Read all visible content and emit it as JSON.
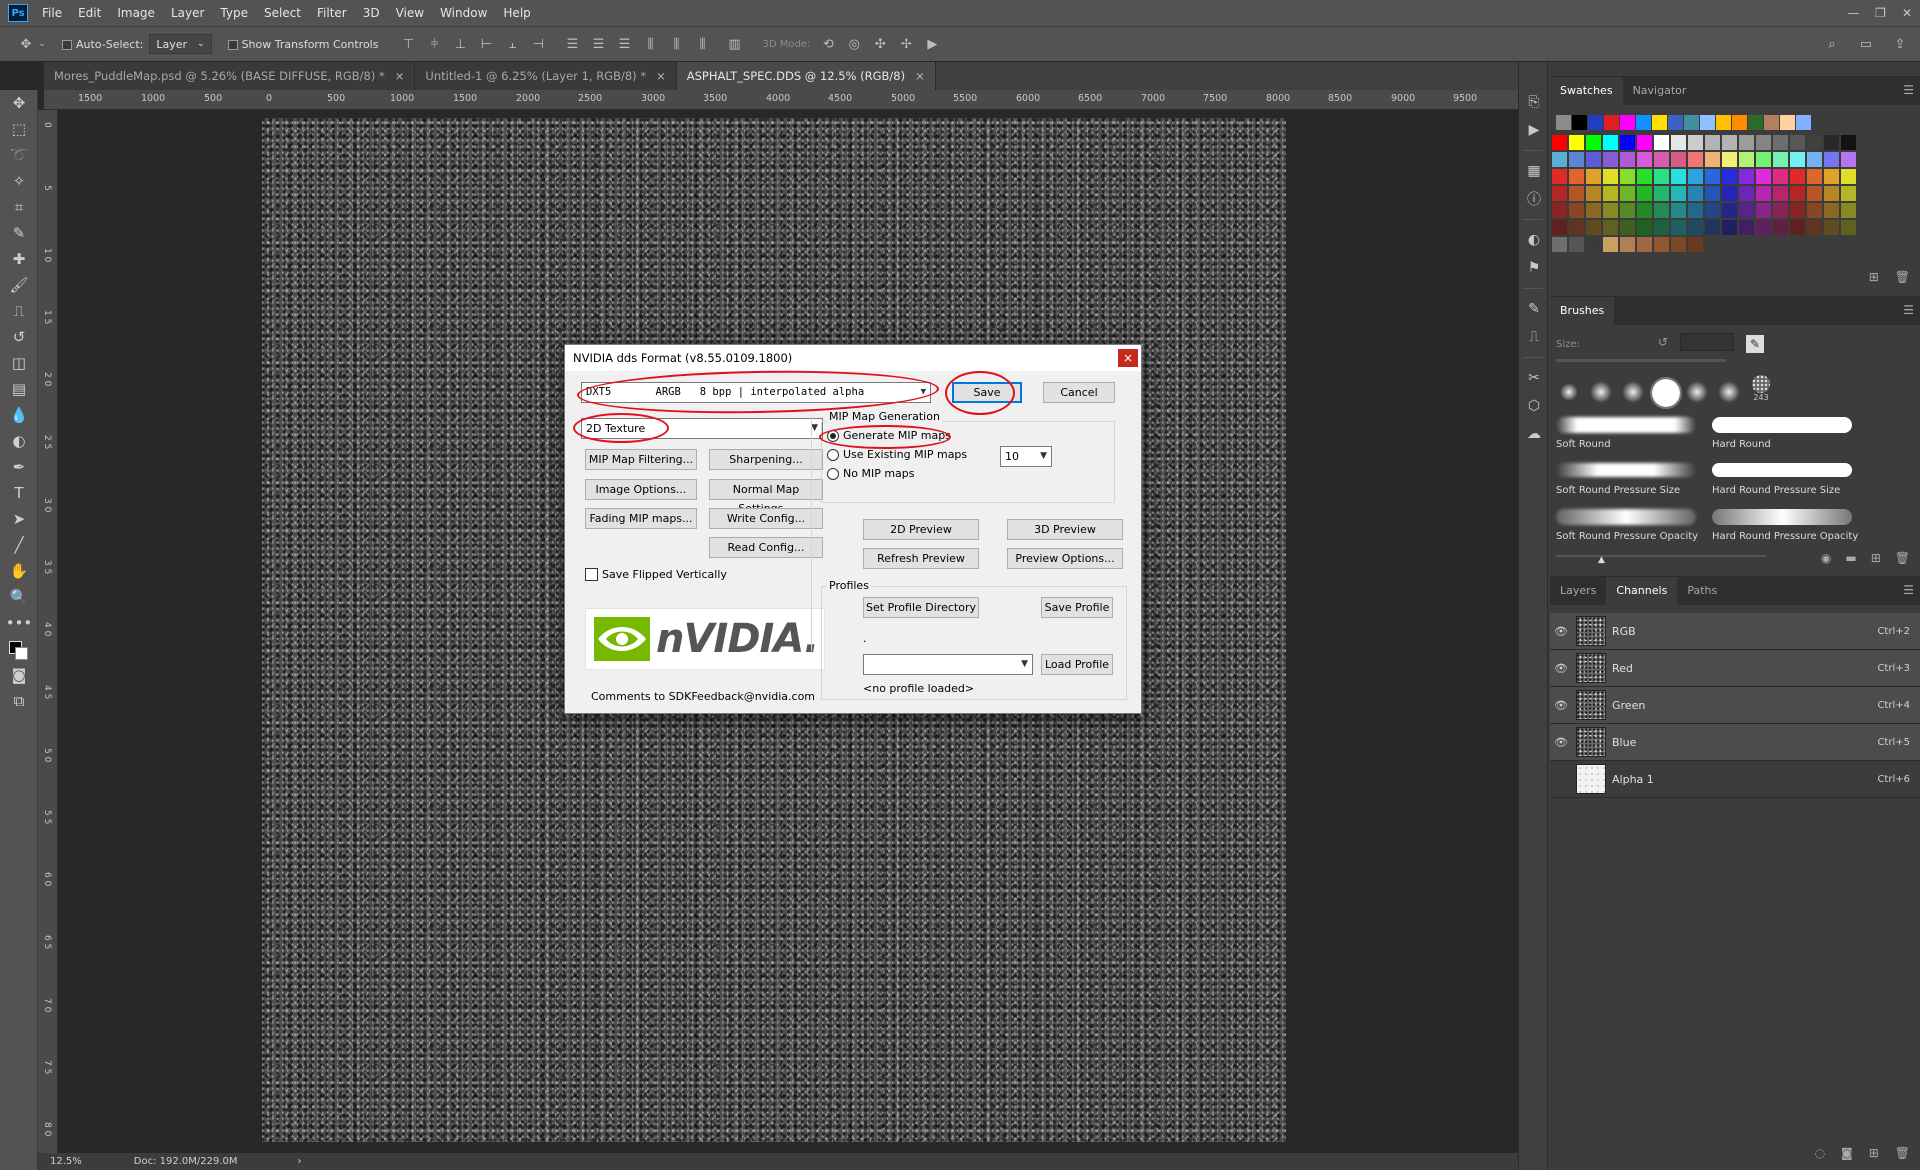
{
  "app": {
    "logo": "Ps"
  },
  "menu": [
    "File",
    "Edit",
    "Image",
    "Layer",
    "Type",
    "Select",
    "Filter",
    "3D",
    "View",
    "Window",
    "Help"
  ],
  "options": {
    "auto_select_label": "Auto-Select:",
    "auto_select_target": "Layer",
    "show_transform_label": "Show Transform Controls",
    "mode_3d_label": "3D Mode:"
  },
  "tabs": [
    {
      "label": "Mores_PuddleMap.psd @ 5.26% (BASE DIFFUSE, RGB/8) *",
      "close": "×"
    },
    {
      "label": "Untitled-1 @ 6.25% (Layer 1, RGB/8) *",
      "close": "×"
    },
    {
      "label": "ASPHALT_SPEC.DDS @ 12.5% (RGB/8)",
      "close": "×"
    }
  ],
  "ruler_top": [
    "1500",
    "1000",
    "500",
    "0",
    "500",
    "1000",
    "1500",
    "2000",
    "2500",
    "3000",
    "3500",
    "4000",
    "4500",
    "5000",
    "5500",
    "6000",
    "6500",
    "7000",
    "7500",
    "8000",
    "8500",
    "9000",
    "9500"
  ],
  "ruler_left": [
    "0",
    "5",
    "1 0",
    "1 5",
    "2 0",
    "2 5",
    "3 0",
    "3 5",
    "4 0",
    "4 5",
    "5 0",
    "5 5",
    "6 0",
    "6 5",
    "7 0",
    "7 5",
    "8 0",
    "8 5"
  ],
  "status": {
    "zoom": "12.5%",
    "doc": "Doc: 192.0M/229.0M",
    "arrow": "›"
  },
  "dialog": {
    "title": "NVIDIA dds Format (v8.55.0109.1800)",
    "close": "×",
    "format": "DXT5       ARGB   8 bpp | interpolated alpha",
    "save": "Save",
    "cancel": "Cancel",
    "texture_type": "2D Texture",
    "buttons_left": [
      "MIP Map Filtering...",
      "Image Options...",
      "Fading MIP maps..."
    ],
    "buttons_mid": [
      "Sharpening...",
      "Normal Map Settings...",
      "Write Config...",
      "Read Config..."
    ],
    "save_flipped": "Save Flipped Vertically",
    "mip_group": "MIP Map Generation",
    "mip_generate": "Generate MIP maps",
    "mip_existing": "Use Existing MIP maps",
    "mip_none": "No MIP maps",
    "mip_count": "10",
    "preview_2d": "2D Preview",
    "preview_3d": "3D Preview",
    "refresh_preview": "Refresh Preview",
    "preview_options": "Preview Options...",
    "profiles_label": "Profiles",
    "set_profile_dir": "Set Profile Directory",
    "save_profile": "Save Profile",
    "profile_path": ".",
    "profile_select": "",
    "load_profile": "Load Profile",
    "no_profile": "<no profile loaded>",
    "comments": "Comments to SDKFeedback@nvidia.com",
    "logo_text": "nVIDIA."
  },
  "swatches_panel": {
    "tabs": [
      "Swatches",
      "Navigator"
    ]
  },
  "brushes_panel": {
    "title": "Brushes",
    "size_label": "Size:",
    "brush_count": "243",
    "strokes": [
      "Soft Round",
      "Hard Round",
      "Soft Round Pressure Size",
      "Hard Round Pressure Size",
      "Soft Round Pressure Opacity",
      "Hard Round Pressure Opacity"
    ]
  },
  "layers_panel": {
    "tabs": [
      "Layers",
      "Channels",
      "Paths"
    ],
    "channels": [
      {
        "name": "RGB",
        "key": "Ctrl+2"
      },
      {
        "name": "Red",
        "key": "Ctrl+3"
      },
      {
        "name": "Green",
        "key": "Ctrl+4"
      },
      {
        "name": "Blue",
        "key": "Ctrl+5"
      },
      {
        "name": "Alpha 1",
        "key": "Ctrl+6"
      }
    ]
  },
  "colors": {
    "accent": "#31a8ff",
    "highlight": "#e0101a"
  }
}
